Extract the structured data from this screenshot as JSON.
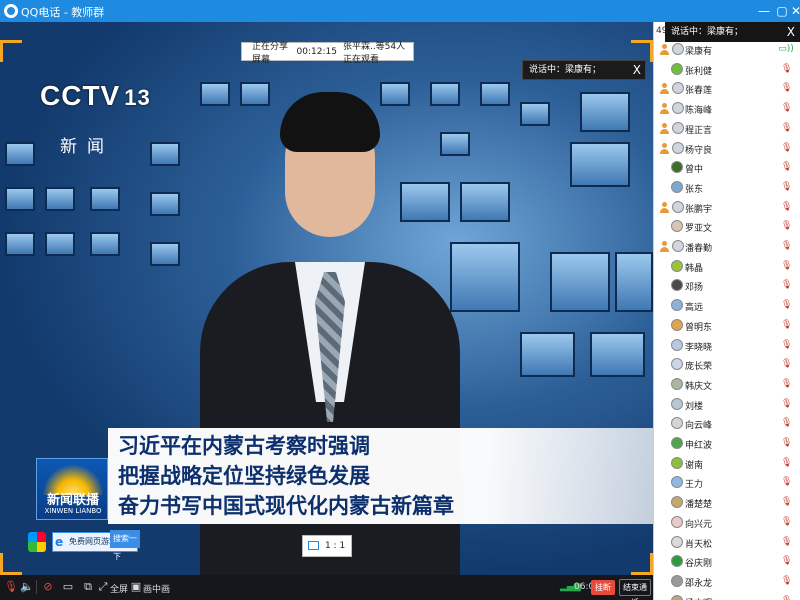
{
  "window": {
    "title": "QQ电话 - 教师群",
    "controls": [
      "—",
      "▢",
      "✕"
    ]
  },
  "video": {
    "channel_logo": "CCTV",
    "channel_num": "13",
    "channel_sub": "新闻",
    "share_bar": {
      "status": "正在分享屏幕",
      "time": "00:12:15",
      "viewers": "张平霖..等54人正在观看"
    },
    "speaking_popup": {
      "label": "说话中：梁康有；",
      "close": "X"
    },
    "caption_lines": [
      "习近平在内蒙古考察时强调",
      "把握战略定位坚持绿色发展",
      "奋力书写中国式现代化内蒙古新篇章"
    ],
    "program_logo_cn": "新闻联播",
    "program_logo_en": "XINWEN LIANBO",
    "browser_widget": {
      "text": "免费网页游戏",
      "button": "搜索一下"
    },
    "ratio_label": "1 : 1"
  },
  "toolbar": {
    "fullscreen_label": "全屏",
    "pip_label": "画中画",
    "time": "06:08",
    "hangup_label": "挂断",
    "end_label": "结束通话"
  },
  "panel": {
    "number": "49",
    "speaking_label": "说话中：梁康有；",
    "close": "X",
    "members": [
      {
        "name": "梁康有",
        "icon": "person",
        "mic": "on"
      },
      {
        "name": "张利健",
        "icon": "avatar",
        "color": "#6fbf3f",
        "mic": "off"
      },
      {
        "name": "张春莲",
        "icon": "person",
        "mic": "off"
      },
      {
        "name": "陈海峰",
        "icon": "person",
        "mic": "off"
      },
      {
        "name": "程正言",
        "icon": "person",
        "mic": "off"
      },
      {
        "name": "杨守良",
        "icon": "person",
        "mic": "off"
      },
      {
        "name": "曾中",
        "icon": "avatar",
        "color": "#3a6f2a",
        "mic": "off"
      },
      {
        "name": "张东",
        "icon": "avatar",
        "color": "#7fa8cf",
        "mic": "off"
      },
      {
        "name": "张鹏宇",
        "icon": "person",
        "mic": "off"
      },
      {
        "name": "罗亚文",
        "icon": "avatar",
        "color": "#d8c7b0",
        "mic": "off"
      },
      {
        "name": "潘春勤",
        "icon": "person",
        "mic": "off"
      },
      {
        "name": "韩晶",
        "icon": "avatar",
        "color": "#9cc23a",
        "mic": "off"
      },
      {
        "name": "邓扬",
        "icon": "avatar",
        "color": "#4a4a4a",
        "mic": "off"
      },
      {
        "name": "高远",
        "icon": "avatar",
        "color": "#8fb1d9",
        "mic": "off"
      },
      {
        "name": "曾明东",
        "icon": "avatar",
        "color": "#e3a34c",
        "mic": "off"
      },
      {
        "name": "李晓晓",
        "icon": "avatar",
        "color": "#b7c9e2",
        "mic": "off"
      },
      {
        "name": "庞长荣",
        "icon": "avatar",
        "color": "#c9d7e8",
        "mic": "off"
      },
      {
        "name": "韩庆文",
        "icon": "avatar",
        "color": "#a9b7a0",
        "mic": "off"
      },
      {
        "name": "刘楼",
        "icon": "avatar",
        "color": "#b8c6d6",
        "mic": "off"
      },
      {
        "name": "向云峰",
        "icon": "avatar",
        "color": "#d4d4d4",
        "mic": "off"
      },
      {
        "name": "申红波",
        "icon": "avatar",
        "color": "#4fa64a",
        "mic": "off"
      },
      {
        "name": "谢南",
        "icon": "avatar",
        "color": "#8cbf3a",
        "mic": "off"
      },
      {
        "name": "王力",
        "icon": "avatar",
        "color": "#8fb8e3",
        "mic": "off"
      },
      {
        "name": "潘楚楚",
        "icon": "avatar",
        "color": "#c9a66b",
        "mic": "off"
      },
      {
        "name": "向兴元",
        "icon": "avatar",
        "color": "#e6c9c9",
        "mic": "off"
      },
      {
        "name": "肖天松",
        "icon": "avatar",
        "color": "#d9d9d9",
        "mic": "off"
      },
      {
        "name": "谷庆刚",
        "icon": "avatar",
        "color": "#2f9c3a",
        "mic": "off"
      },
      {
        "name": "邵永龙",
        "icon": "avatar",
        "color": "#9a9a9a",
        "mic": "off"
      },
      {
        "name": "杨文辉",
        "icon": "avatar",
        "color": "#c2a57a",
        "mic": "off"
      }
    ]
  }
}
